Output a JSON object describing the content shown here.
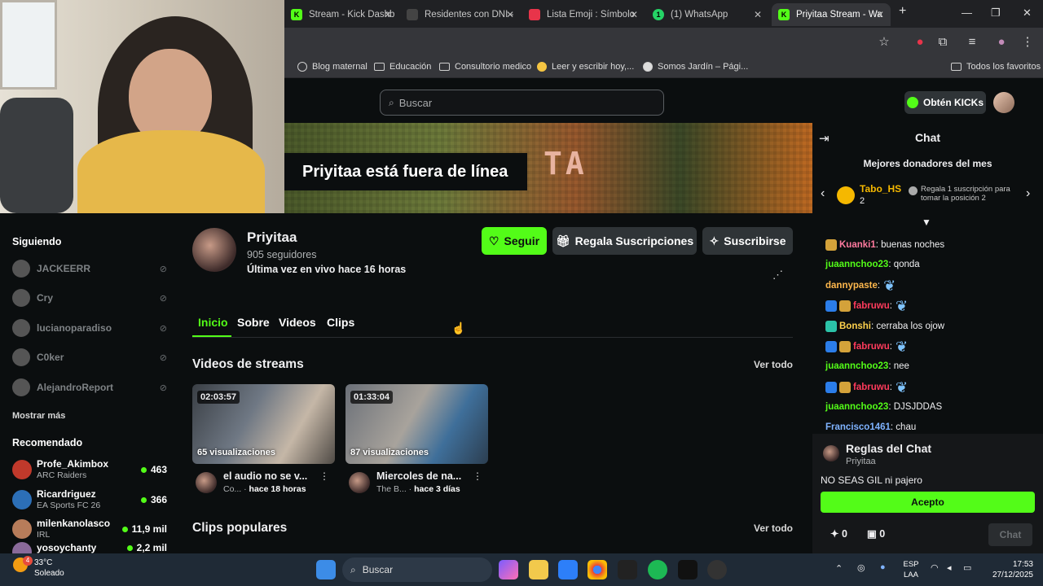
{
  "browser": {
    "tabs": [
      {
        "label": "Stream - Kick Dashb",
        "color": "#53fc18",
        "glyph": "K"
      },
      {
        "label": "Residentes con DNI -",
        "color": "#444444",
        "glyph": ""
      },
      {
        "label": "Lista Emoji : Símbolo",
        "color": "#e8344a",
        "glyph": ""
      },
      {
        "label": "(1) WhatsApp",
        "color": "#25d366",
        "glyph": "1"
      },
      {
        "label": "Priyitaa Stream - Wa",
        "color": "#53fc18",
        "glyph": "K"
      }
    ],
    "bookmarks": [
      "Blog maternal",
      "Educación",
      "Consultorio medico",
      "Leer y escribir hoy,...",
      "Somos Jardín – Pági..."
    ],
    "all_bookmarks": "Todos los favoritos"
  },
  "header": {
    "search_placeholder": "Buscar",
    "kicks_button": "Obtén KICKs"
  },
  "banner": {
    "offline_text": "Priyitaa está fuera de línea",
    "art_text": "TA"
  },
  "channel": {
    "name": "Priyitaa",
    "followers": "905 seguidores",
    "last_live": "Última vez en vivo hace 16 horas",
    "follow": "Seguir",
    "gift": "Regala Suscripciones",
    "subscribe": "Suscribirse",
    "tabs": [
      "Inicio",
      "Sobre",
      "Videos",
      "Clips"
    ]
  },
  "sections": {
    "videos_title": "Videos de streams",
    "see_all": "Ver todo",
    "clips_title": "Clips populares"
  },
  "videos": [
    {
      "duration": "02:03:57",
      "views": "65 visualizaciones",
      "title": "el audio no se v...",
      "category": "Co...",
      "time": "hace 18 horas"
    },
    {
      "duration": "01:33:04",
      "views": "87 visualizaciones",
      "title": "Miercoles de na...",
      "category": "The B...",
      "time": "hace 3 días"
    }
  ],
  "sidebar": {
    "following_title": "Siguiendo",
    "following": [
      "JACKEERR",
      "Cry",
      "lucianoparadiso",
      "C0ker",
      "AlejandroReport"
    ],
    "show_more": "Mostrar más",
    "recommended_title": "Recomendado",
    "recommended": [
      {
        "name": "Profe_Akimbox",
        "category": "ARC Raiders",
        "viewers": "463",
        "color": "#c0392b"
      },
      {
        "name": "Ricardriguez",
        "category": "EA Sports FC 26",
        "viewers": "366",
        "color": "#2c6fb7"
      },
      {
        "name": "milenkanolasco",
        "category": "IRL",
        "viewers": "11,9 mil",
        "color": "#b77c5a"
      },
      {
        "name": "yosoychanty",
        "category": "",
        "viewers": "2,2 mil",
        "color": "#8a6a9a"
      }
    ]
  },
  "chat": {
    "title": "Chat",
    "top_donors": "Mejores donadores del mes",
    "donor_name": "Tabo_HS",
    "donor_rank": "2",
    "donor_cta": "Regala 1 suscripción para tomar la posición 2",
    "messages": [
      {
        "user": "Kuanki1",
        "color": "#ff7a9f",
        "text": ": buenas noches"
      },
      {
        "user": "juaannchoo23",
        "color": "#53fc18",
        "text": ": qonda"
      },
      {
        "user": "dannypaste",
        "color": "#ffb84d",
        "text": ":"
      },
      {
        "user": "fabruwu",
        "color": "#ff3b5c",
        "text": ":"
      },
      {
        "user": "Bonshi",
        "color": "#ffd24d",
        "text": ": cerraba los ojow"
      },
      {
        "user": "fabruwu",
        "color": "#ff3b5c",
        "text": ":"
      },
      {
        "user": "juaannchoo23",
        "color": "#53fc18",
        "text": ": nee"
      },
      {
        "user": "fabruwu",
        "color": "#ff3b5c",
        "text": ":"
      },
      {
        "user": "juaannchoo23",
        "color": "#53fc18",
        "text": ": DJSJDDAS"
      },
      {
        "user": "Francisco1461",
        "color": "#7fb3ff",
        "text": ": chau"
      }
    ],
    "rules_title": "Reglas del Chat",
    "rules_channel": "Priyitaa",
    "rules_text": "NO SEAS GIL ni pajero",
    "accept": "Acepto",
    "kicks_count": "0",
    "gifts_count": "0",
    "send": "Chat"
  },
  "taskbar": {
    "temp": "33°C",
    "weather": "Soleado",
    "weather_badge": "4",
    "search": "Buscar",
    "lang1": "ESP",
    "lang2": "LAA",
    "time": "17:53",
    "date": "27/12/2025"
  },
  "colors": {
    "kick_green": "#53fc18",
    "bg": "#0b0e0f"
  }
}
